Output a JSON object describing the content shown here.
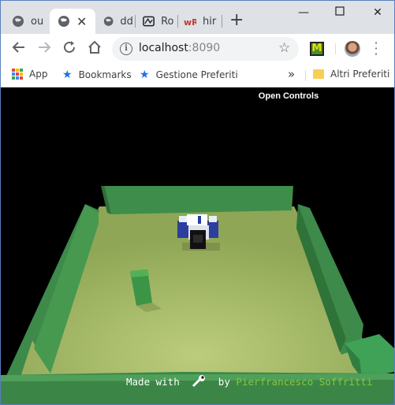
{
  "tabs": [
    {
      "title": "ou",
      "icon": "globe-icon",
      "active": false
    },
    {
      "title": "",
      "icon": "globe-icon",
      "active": true
    },
    {
      "title": "dd",
      "icon": "globe-icon",
      "active": false
    },
    {
      "title": "Ro",
      "icon": "book-icon",
      "active": false
    },
    {
      "title": "hir",
      "icon": "wr-icon",
      "active": false
    }
  ],
  "toolbar": {
    "url_host": "localhost",
    "url_port": ":8090"
  },
  "bookmarks": {
    "apps_label": "App",
    "items": [
      "Bookmarks",
      "Gestione Preferiti"
    ],
    "overflow": "»",
    "other_label": "Altri Preferiti"
  },
  "content": {
    "open_controls_label": "Open Controls",
    "credit_made_with": "Made with",
    "credit_by": "by",
    "credit_author": "Pierfrancesco Soffritti"
  },
  "colors": {
    "floor": "#a6bd6a",
    "wall": "#3d8a4a",
    "obstacle": "#3c9447",
    "robot_accent": "#2c3e9e"
  }
}
